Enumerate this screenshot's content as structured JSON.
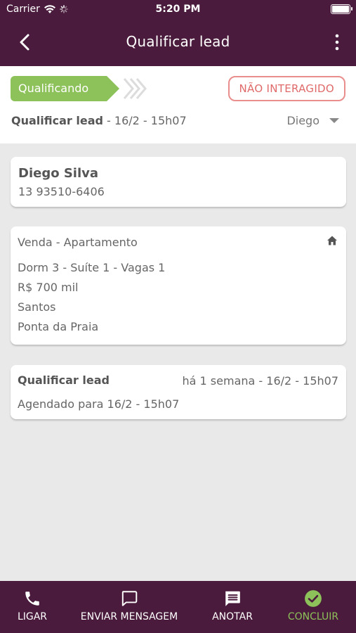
{
  "status_bar": {
    "carrier": "Carrier",
    "time": "5:20 PM"
  },
  "nav": {
    "title": "Qualificar lead",
    "back_icon": "chevron-left-icon",
    "more_icon": "more-vertical-icon"
  },
  "stage": {
    "label": "Qualificando",
    "status_badge": "NÃO INTERAGIDO",
    "step_title": "Qualificar lead",
    "step_datetime": " - 16/2 - 15h07",
    "assignee": "Diego"
  },
  "contact": {
    "name": "Diego Silva",
    "phone": "13 93510-6406"
  },
  "interest": {
    "title": "Venda - Apartamento",
    "lines": [
      "Dorm 3 - Suíte 1 - Vagas 1",
      "R$ 700 mil",
      "Santos",
      "Ponta da Praia"
    ]
  },
  "activity": {
    "title": "Qualificar lead",
    "when": "há 1 semana - 16/2 - 15h07",
    "scheduled": "Agendado para 16/2 - 15h07"
  },
  "bottom_tabs": [
    {
      "label": "LIGAR",
      "icon": "phone-icon"
    },
    {
      "label": "ENVIAR MENSAGEM",
      "icon": "message-icon"
    },
    {
      "label": "ANOTAR",
      "icon": "note-icon"
    },
    {
      "label": "CONCLUIR",
      "icon": "check-circle-icon"
    }
  ],
  "colors": {
    "brand": "#4a1b3c",
    "stage_green": "#8dc15a",
    "badge_red": "#e06a6a",
    "background": "#e9e9e9"
  }
}
